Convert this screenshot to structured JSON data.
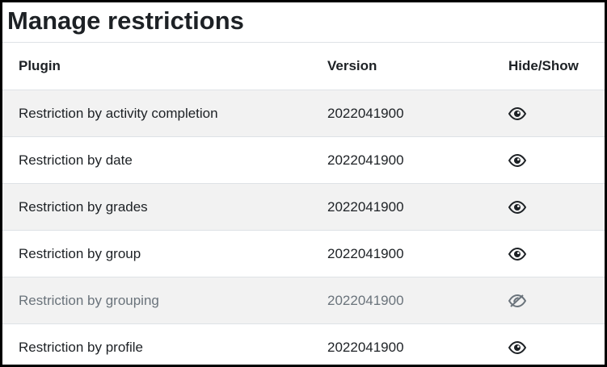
{
  "page": {
    "title": "Manage restrictions"
  },
  "table": {
    "headers": {
      "plugin": "Plugin",
      "version": "Version",
      "hide_show": "Hide/Show"
    },
    "rows": [
      {
        "name": "Restriction by activity completion",
        "version": "2022041900",
        "visibility_icon": "eye-icon",
        "enabled": true
      },
      {
        "name": "Restriction by date",
        "version": "2022041900",
        "visibility_icon": "eye-icon",
        "enabled": true
      },
      {
        "name": "Restriction by grades",
        "version": "2022041900",
        "visibility_icon": "eye-icon",
        "enabled": true
      },
      {
        "name": "Restriction by group",
        "version": "2022041900",
        "visibility_icon": "eye-icon",
        "enabled": true
      },
      {
        "name": "Restriction by grouping",
        "version": "2022041900",
        "visibility_icon": "eye-slash-icon",
        "enabled": false
      },
      {
        "name": "Restriction by profile",
        "version": "2022041900",
        "visibility_icon": "eye-icon",
        "enabled": true
      }
    ]
  },
  "colors": {
    "text": "#1d2125",
    "disabled_text": "#6a737b",
    "stripe": "#f2f2f2",
    "border": "#dee2e6"
  }
}
